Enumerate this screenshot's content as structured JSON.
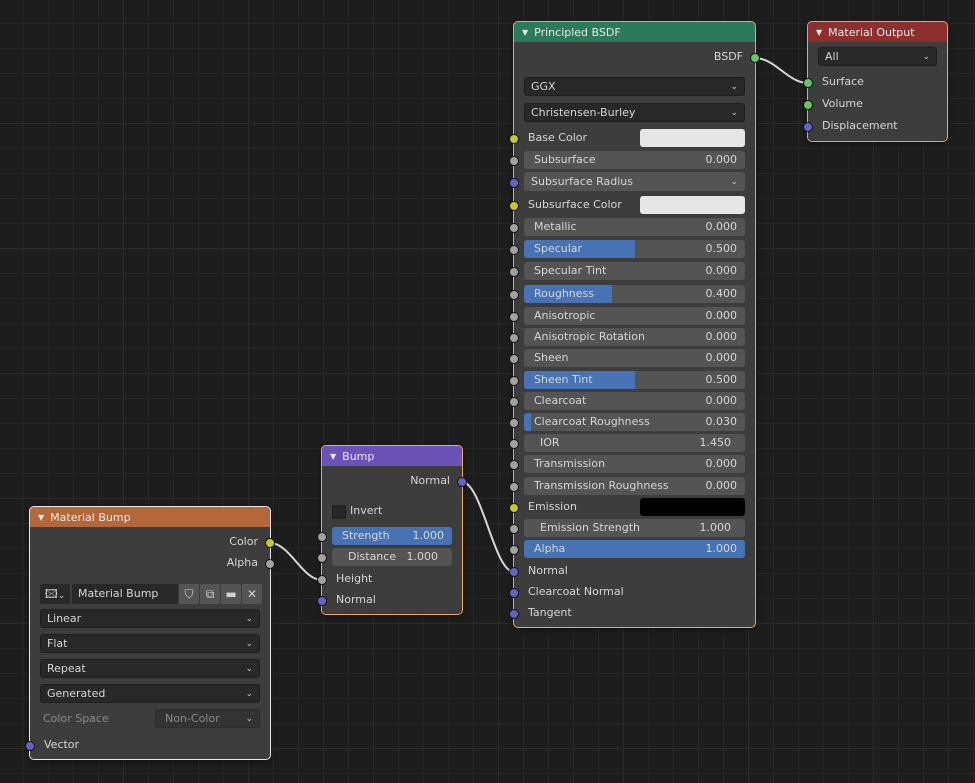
{
  "colors": {
    "header_shader": "#2b7b5a",
    "header_output": "#8c2f2f",
    "header_vector": "#6a52b8",
    "header_texture": "#b3673b",
    "slider_fill": "#4772b3",
    "link": "#d6d6d6"
  },
  "principled": {
    "title": "Principled BSDF",
    "output": "BSDF",
    "distribution": "GGX",
    "subsurface_method": "Christensen-Burley",
    "base_color_label": "Base Color",
    "base_color_value": "#e6e6e6",
    "subsurface_radius_label": "Subsurface Radius",
    "subsurface_color_label": "Subsurface Color",
    "subsurface_color_value": "#e6e6e6",
    "emission_label": "Emission",
    "emission_color_value": "#000000",
    "sliders": [
      {
        "name": "Subsurface",
        "value": "0.000",
        "fraction": 0
      },
      {
        "name": "Metallic",
        "value": "0.000",
        "fraction": 0
      },
      {
        "name": "Specular",
        "value": "0.500",
        "fraction": 0.5
      },
      {
        "name": "Specular Tint",
        "value": "0.000",
        "fraction": 0
      },
      {
        "name": "Roughness",
        "value": "0.400",
        "fraction": 0.4
      },
      {
        "name": "Anisotropic",
        "value": "0.000",
        "fraction": 0
      },
      {
        "name": "Anisotropic Rotation",
        "value": "0.000",
        "fraction": 0
      },
      {
        "name": "Sheen",
        "value": "0.000",
        "fraction": 0
      },
      {
        "name": "Sheen Tint",
        "value": "0.500",
        "fraction": 0.5
      },
      {
        "name": "Clearcoat",
        "value": "0.000",
        "fraction": 0
      },
      {
        "name": "Clearcoat Roughness",
        "value": "0.030",
        "fraction": 0.03
      },
      {
        "name": "IOR",
        "value": "1.450",
        "fraction": 0
      },
      {
        "name": "Transmission",
        "value": "0.000",
        "fraction": 0
      },
      {
        "name": "Transmission Roughness",
        "value": "0.000",
        "fraction": 0
      },
      {
        "name": "Emission Strength",
        "value": "1.000",
        "fraction": 0
      },
      {
        "name": "Alpha",
        "value": "1.000",
        "fraction": 1
      }
    ],
    "inputs_bottom": [
      "Normal",
      "Clearcoat Normal",
      "Tangent"
    ]
  },
  "output": {
    "title": "Material Output",
    "target": "All",
    "inputs": [
      "Surface",
      "Volume",
      "Displacement"
    ]
  },
  "bump": {
    "title": "Bump",
    "output": "Normal",
    "invert_label": "Invert",
    "strength": {
      "name": "Strength",
      "value": "1.000",
      "fraction": 1
    },
    "distance": {
      "name": "Distance",
      "value": "1.000",
      "fraction": 0
    },
    "inputs": [
      "Height",
      "Normal"
    ]
  },
  "texture": {
    "title": "Material Bump",
    "outputs": [
      "Color",
      "Alpha"
    ],
    "image_name": "Material Bump",
    "interpolation": "Linear",
    "projection": "Flat",
    "extension": "Repeat",
    "source": "Generated",
    "color_space_label": "Color Space",
    "color_space_value": "Non-Color",
    "input": "Vector"
  }
}
